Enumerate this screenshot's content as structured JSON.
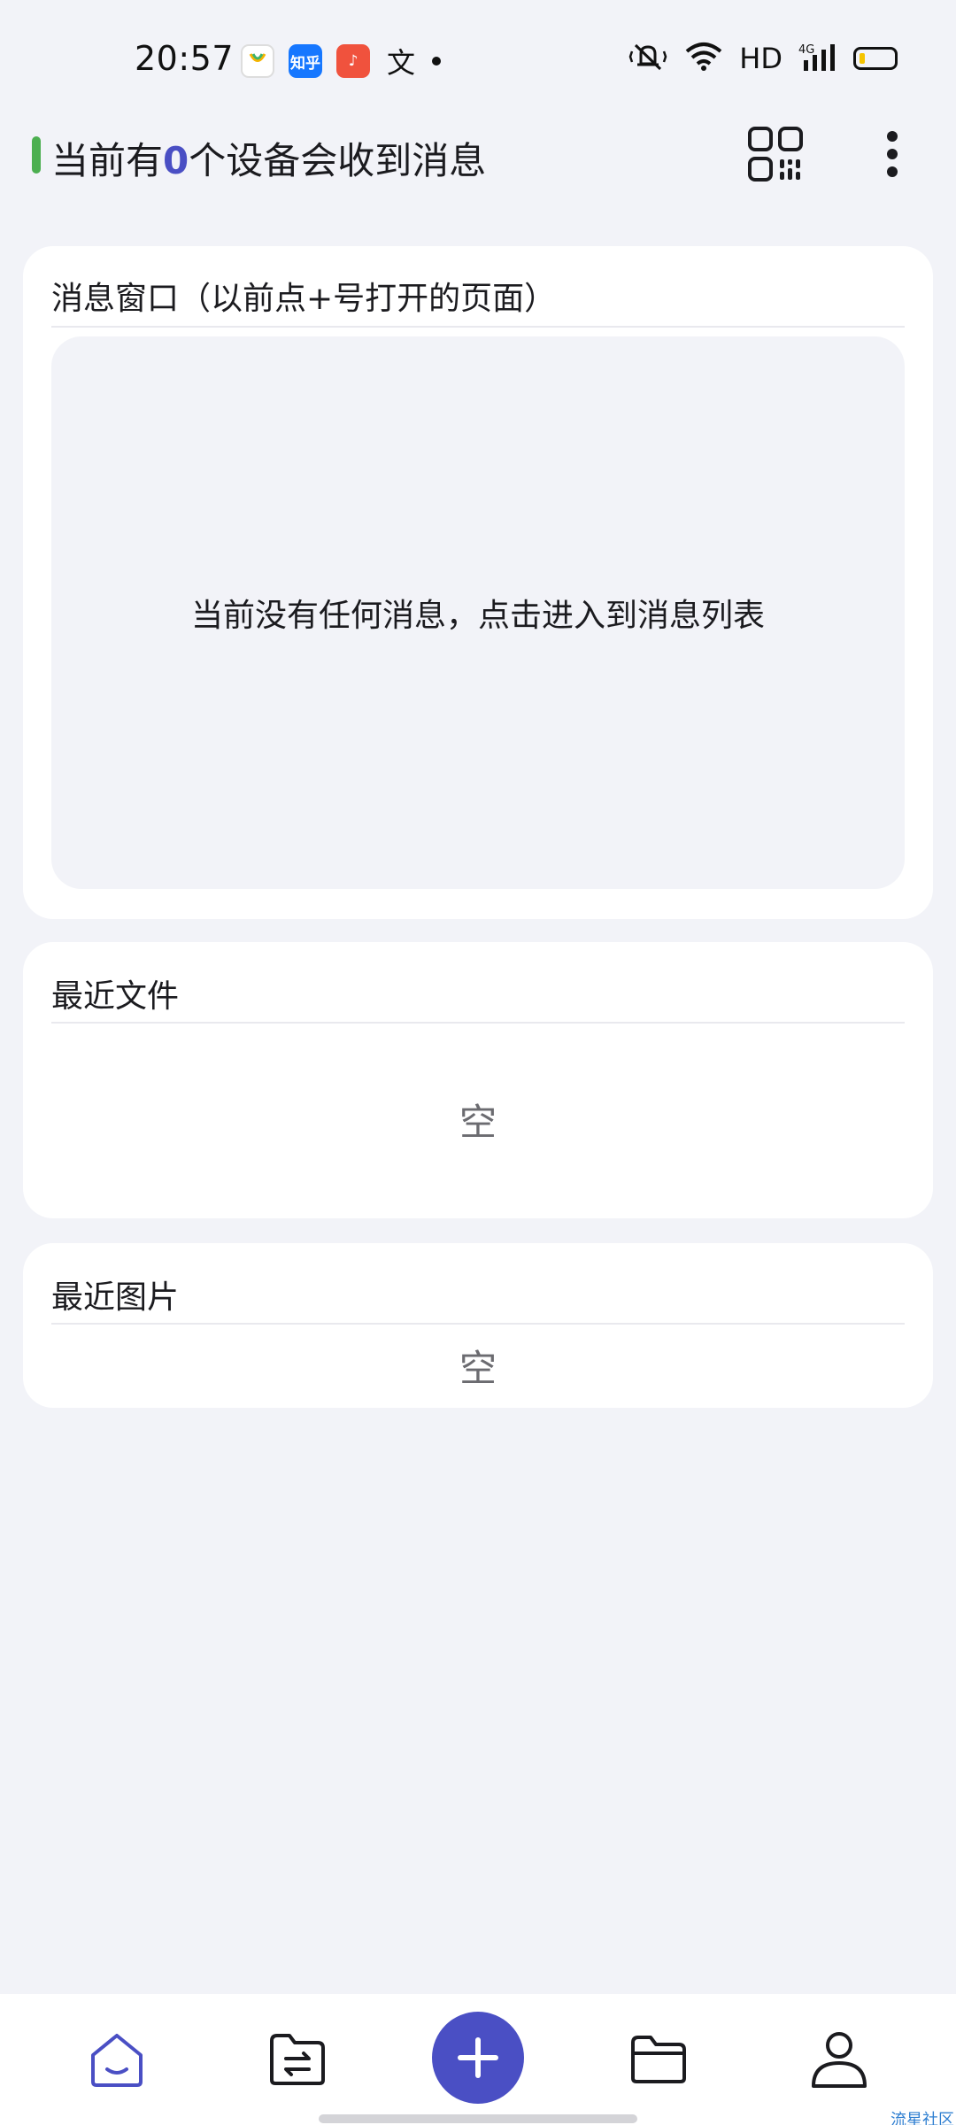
{
  "status_bar": {
    "time": "20:57",
    "apps": [
      {
        "icon": "app-icon-1",
        "label": ""
      },
      {
        "icon": "zhihu-icon",
        "label": "知乎"
      },
      {
        "icon": "music-icon",
        "label": "♪"
      },
      {
        "icon": "translate-icon",
        "label": "文"
      }
    ],
    "network": "HD",
    "signal": "4G",
    "battery_color": "#f5c400"
  },
  "header": {
    "prefix": "当前有",
    "count": "0",
    "suffix": "个设备会收到消息",
    "indicator_color": "#4caf50",
    "accent_color": "#4a4fc4"
  },
  "message_card": {
    "title": "消息窗口（以前点+号打开的页面）",
    "empty_text": "当前没有任何消息，点击进入到消息列表"
  },
  "files_card": {
    "title": "最近文件",
    "empty_text": "空"
  },
  "images_card": {
    "title": "最近图片",
    "empty_text": "空"
  },
  "bottom_nav": {
    "items": [
      {
        "icon": "home-icon",
        "active": true
      },
      {
        "icon": "file-transfer-icon",
        "active": false
      },
      {
        "icon": "add-icon",
        "active": false
      },
      {
        "icon": "folder-icon",
        "active": false
      },
      {
        "icon": "person-icon",
        "active": false
      }
    ]
  },
  "watermark": "流星社区"
}
